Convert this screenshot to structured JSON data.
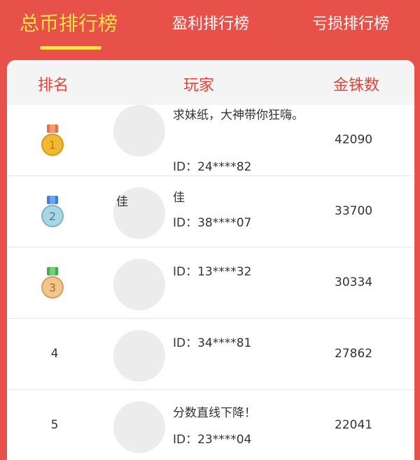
{
  "tabs": [
    {
      "label": "总币排行榜",
      "active": true
    },
    {
      "label": "盈利排行榜",
      "active": false
    },
    {
      "label": "亏损排行榜",
      "active": false
    }
  ],
  "table": {
    "headers": {
      "rank": "排名",
      "player": "玩家",
      "coins": "金铢数"
    },
    "rows": [
      {
        "rank": "1",
        "medal": "gold",
        "name": "求妹纸，大神带你狂嗨。",
        "avatar_text": "",
        "id": "ID：24****82",
        "coins": "42090"
      },
      {
        "rank": "2",
        "medal": "silver",
        "name": "佳",
        "avatar_text": "佳",
        "id": "ID：38****07",
        "coins": "33700"
      },
      {
        "rank": "3",
        "medal": "bronze",
        "name": "",
        "avatar_text": "",
        "id": "ID：13****32",
        "coins": "30334"
      },
      {
        "rank": "4",
        "medal": "",
        "name": "",
        "avatar_text": "",
        "id": "ID：34****81",
        "coins": "27862"
      },
      {
        "rank": "5",
        "medal": "",
        "name": "分数直线下降！",
        "avatar_text": "",
        "id": "ID：23****04",
        "coins": "22041"
      }
    ]
  },
  "colors": {
    "background": "#e8504a",
    "active_tab": "#ffe14a",
    "header_text": "#e0443a",
    "medal_gold": "#f2b830",
    "medal_silver": "#a9d6e5",
    "medal_bronze": "#f2c48e"
  }
}
